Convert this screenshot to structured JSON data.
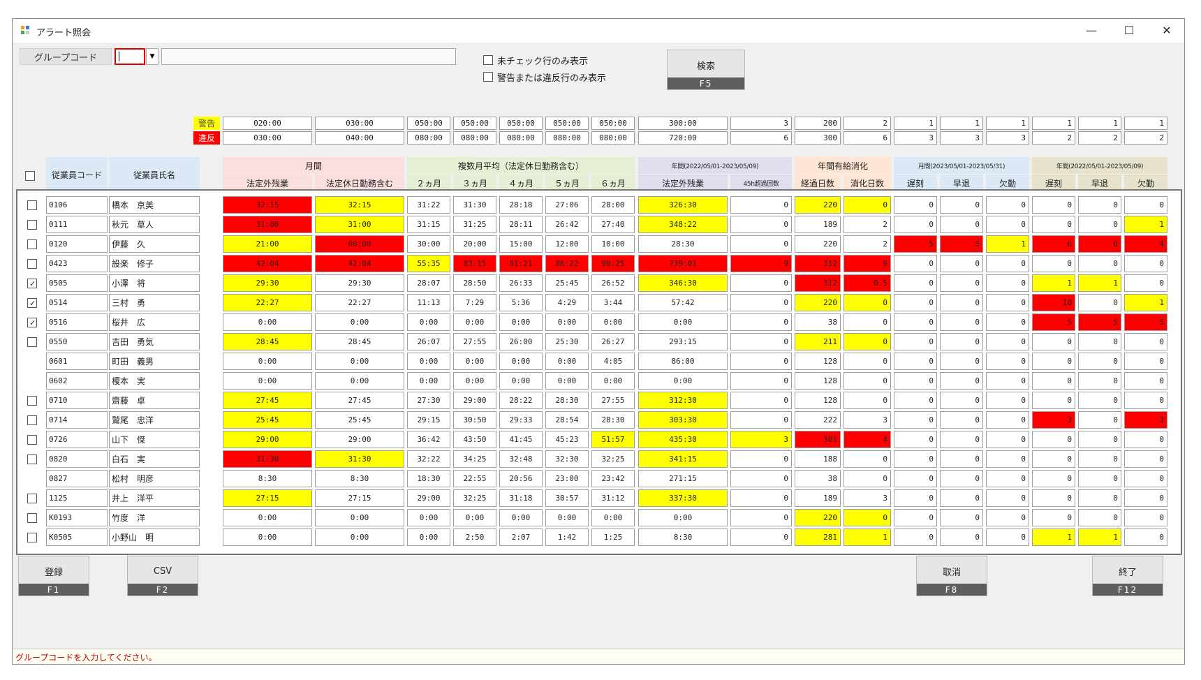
{
  "window": {
    "title": "アラート照会",
    "minimize": "—",
    "maximize": "☐",
    "close": "✕"
  },
  "search": {
    "group_code_label": "グループコード",
    "group_code_value": "",
    "dropdown_arrow": "▼",
    "group_name_value": "",
    "only_unchecked_label": "未チェック行のみ表示",
    "only_warning_label": "警告または違反行のみ表示",
    "search_button_label": "検索",
    "search_button_key": "F5"
  },
  "thresholds": {
    "warning_label": "警告",
    "violation_label": "違反",
    "warning": [
      "020:00",
      "030:00",
      "050:00",
      "050:00",
      "050:00",
      "050:00",
      "050:00",
      "300:00",
      "3",
      "200",
      "2",
      "1",
      "1",
      "1",
      "1",
      "1",
      "1"
    ],
    "violation": [
      "030:00",
      "040:00",
      "080:00",
      "080:00",
      "080:00",
      "080:00",
      "080:00",
      "720:00",
      "6",
      "300",
      "6",
      "3",
      "3",
      "3",
      "2",
      "2",
      "2"
    ]
  },
  "headers": {
    "employee_code": "従業員コード",
    "employee_name": "従業員氏名",
    "group_monthly": "月間",
    "group_multi_month": "複数月平均（法定休日勤務含む）",
    "group_yearly": "年間(2022/05/01-2023/05/09)",
    "group_paid_leave": "年間有給消化",
    "group_monthly_att": "月間(2023/05/01-2023/05/31)",
    "group_yearly_att": "年間(2022/05/01-2023/05/09)",
    "columns": [
      "法定外残業",
      "法定休日勤務含む",
      "２ヵ月",
      "３ヵ月",
      "４ヵ月",
      "５ヵ月",
      "６ヵ月",
      "法定外残業",
      "45h超過回数",
      "経過日数",
      "消化日数",
      "遅刻",
      "早退",
      "欠勤",
      "遅刻",
      "早退",
      "欠勤"
    ]
  },
  "colors": {
    "warning": "#ffff00",
    "violation": "#ff0000",
    "monthly_head": "#fbdede",
    "multi_head": "#e4efd4",
    "yearly_head": "#e2dcef",
    "leave_head": "#fde4d3",
    "att_head": "#dbe9f7",
    "yatt_head": "#e7e2cc",
    "code_head": "#dbe8f6"
  },
  "rows": [
    {
      "checkbox": "unchecked",
      "code": "0106",
      "name": "橋本　京美",
      "values": [
        "32:15",
        "32:15",
        "31:22",
        "31:30",
        "28:18",
        "27:06",
        "28:00",
        "326:30",
        "0",
        "220",
        "0",
        "0",
        "0",
        "0",
        "0",
        "0",
        "0"
      ],
      "levels": [
        2,
        1,
        0,
        0,
        0,
        0,
        0,
        1,
        0,
        1,
        1,
        0,
        0,
        0,
        0,
        0,
        0
      ]
    },
    {
      "checkbox": "unchecked",
      "code": "0111",
      "name": "秋元　草人",
      "values": [
        "31:00",
        "31:00",
        "31:15",
        "31:25",
        "28:11",
        "26:42",
        "27:40",
        "348:22",
        "0",
        "189",
        "2",
        "0",
        "0",
        "0",
        "0",
        "0",
        "1"
      ],
      "levels": [
        2,
        1,
        0,
        0,
        0,
        0,
        0,
        1,
        0,
        0,
        0,
        0,
        0,
        0,
        0,
        0,
        1
      ]
    },
    {
      "checkbox": "unchecked",
      "code": "0120",
      "name": "伊藤　久",
      "values": [
        "21:00",
        "60:00",
        "30:00",
        "20:00",
        "15:00",
        "12:00",
        "10:00",
        "28:30",
        "0",
        "220",
        "2",
        "5",
        "5",
        "1",
        "6",
        "6",
        "4"
      ],
      "levels": [
        1,
        2,
        0,
        0,
        0,
        0,
        0,
        0,
        0,
        0,
        0,
        2,
        2,
        1,
        2,
        2,
        2
      ]
    },
    {
      "checkbox": "unchecked",
      "code": "0423",
      "name": "設楽　修子",
      "values": [
        "42:04",
        "42:04",
        "55:35",
        "83:15",
        "81:21",
        "86:22",
        "90:25",
        "739:01",
        "9",
        "312",
        "9",
        "0",
        "0",
        "0",
        "0",
        "0",
        "0"
      ],
      "levels": [
        2,
        2,
        1,
        2,
        2,
        2,
        2,
        2,
        2,
        2,
        2,
        0,
        0,
        0,
        0,
        0,
        0
      ]
    },
    {
      "checkbox": "checked",
      "code": "0505",
      "name": "小澤　将",
      "values": [
        "29:30",
        "29:30",
        "28:07",
        "28:50",
        "26:33",
        "25:45",
        "26:52",
        "346:30",
        "0",
        "312",
        "0.5",
        "0",
        "0",
        "0",
        "1",
        "1",
        "0"
      ],
      "levels": [
        1,
        0,
        0,
        0,
        0,
        0,
        0,
        1,
        0,
        2,
        2,
        0,
        0,
        0,
        1,
        1,
        0
      ]
    },
    {
      "checkbox": "checked",
      "code": "0514",
      "name": "三村　勇",
      "values": [
        "22:27",
        "22:27",
        "11:13",
        "7:29",
        "5:36",
        "4:29",
        "3:44",
        "57:42",
        "0",
        "220",
        "0",
        "0",
        "0",
        "0",
        "10",
        "0",
        "1"
      ],
      "levels": [
        1,
        0,
        0,
        0,
        0,
        0,
        0,
        0,
        0,
        1,
        1,
        0,
        0,
        0,
        2,
        0,
        1
      ]
    },
    {
      "checkbox": "checked",
      "code": "0516",
      "name": "桜井　広",
      "values": [
        "0:00",
        "0:00",
        "0:00",
        "0:00",
        "0:00",
        "0:00",
        "0:00",
        "0:00",
        "0",
        "38",
        "0",
        "0",
        "0",
        "0",
        "5",
        "5",
        "5"
      ],
      "levels": [
        0,
        0,
        0,
        0,
        0,
        0,
        0,
        0,
        0,
        0,
        0,
        0,
        0,
        0,
        2,
        2,
        2
      ]
    },
    {
      "checkbox": "unchecked",
      "code": "0550",
      "name": "吉田　勇気",
      "values": [
        "28:45",
        "28:45",
        "26:07",
        "27:55",
        "26:00",
        "25:30",
        "26:27",
        "293:15",
        "0",
        "211",
        "0",
        "0",
        "0",
        "0",
        "0",
        "0",
        "0"
      ],
      "levels": [
        1,
        0,
        0,
        0,
        0,
        0,
        0,
        0,
        0,
        1,
        1,
        0,
        0,
        0,
        0,
        0,
        0
      ]
    },
    {
      "checkbox": "none",
      "code": "0601",
      "name": "町田　義男",
      "values": [
        "0:00",
        "0:00",
        "0:00",
        "0:00",
        "0:00",
        "0:00",
        "4:05",
        "86:00",
        "0",
        "128",
        "0",
        "0",
        "0",
        "0",
        "0",
        "0",
        "0"
      ],
      "levels": [
        0,
        0,
        0,
        0,
        0,
        0,
        0,
        0,
        0,
        0,
        0,
        0,
        0,
        0,
        0,
        0,
        0
      ]
    },
    {
      "checkbox": "none",
      "code": "0602",
      "name": "榎本　実",
      "values": [
        "0:00",
        "0:00",
        "0:00",
        "0:00",
        "0:00",
        "0:00",
        "0:00",
        "0:00",
        "0",
        "128",
        "0",
        "0",
        "0",
        "0",
        "0",
        "0",
        "0"
      ],
      "levels": [
        0,
        0,
        0,
        0,
        0,
        0,
        0,
        0,
        0,
        0,
        0,
        0,
        0,
        0,
        0,
        0,
        0
      ]
    },
    {
      "checkbox": "unchecked",
      "code": "0710",
      "name": "齋藤　卓",
      "values": [
        "27:45",
        "27:45",
        "27:30",
        "29:00",
        "28:22",
        "28:30",
        "27:55",
        "312:30",
        "0",
        "128",
        "0",
        "0",
        "0",
        "0",
        "0",
        "0",
        "0"
      ],
      "levels": [
        1,
        0,
        0,
        0,
        0,
        0,
        0,
        1,
        0,
        0,
        0,
        0,
        0,
        0,
        0,
        0,
        0
      ]
    },
    {
      "checkbox": "unchecked",
      "code": "0714",
      "name": "鷲尾　忠洋",
      "values": [
        "25:45",
        "25:45",
        "29:15",
        "30:50",
        "29:33",
        "28:54",
        "28:30",
        "303:30",
        "0",
        "222",
        "3",
        "0",
        "0",
        "0",
        "3",
        "0",
        "3"
      ],
      "levels": [
        1,
        0,
        0,
        0,
        0,
        0,
        0,
        1,
        0,
        0,
        0,
        0,
        0,
        0,
        2,
        0,
        2
      ]
    },
    {
      "checkbox": "unchecked",
      "code": "0726",
      "name": "山下　傑",
      "values": [
        "29:00",
        "29:00",
        "36:42",
        "43:50",
        "41:45",
        "45:23",
        "51:57",
        "435:30",
        "3",
        "301",
        "4",
        "0",
        "0",
        "0",
        "0",
        "0",
        "0"
      ],
      "levels": [
        1,
        0,
        0,
        0,
        0,
        0,
        1,
        1,
        1,
        2,
        2,
        0,
        0,
        0,
        0,
        0,
        0
      ]
    },
    {
      "checkbox": "unchecked",
      "code": "0820",
      "name": "白石　実",
      "values": [
        "31:30",
        "31:30",
        "32:22",
        "34:25",
        "32:48",
        "32:30",
        "32:25",
        "341:15",
        "0",
        "188",
        "0",
        "0",
        "0",
        "0",
        "0",
        "0",
        "0"
      ],
      "levels": [
        2,
        1,
        0,
        0,
        0,
        0,
        0,
        1,
        0,
        0,
        0,
        0,
        0,
        0,
        0,
        0,
        0
      ]
    },
    {
      "checkbox": "none",
      "code": "0827",
      "name": "松村　明彦",
      "values": [
        "8:30",
        "8:30",
        "18:30",
        "22:55",
        "20:56",
        "23:00",
        "23:42",
        "271:15",
        "0",
        "38",
        "0",
        "0",
        "0",
        "0",
        "0",
        "0",
        "0"
      ],
      "levels": [
        0,
        0,
        0,
        0,
        0,
        0,
        0,
        0,
        0,
        0,
        0,
        0,
        0,
        0,
        0,
        0,
        0
      ]
    },
    {
      "checkbox": "unchecked",
      "code": "1125",
      "name": "井上　洋平",
      "values": [
        "27:15",
        "27:15",
        "29:00",
        "32:25",
        "31:18",
        "30:57",
        "31:12",
        "337:30",
        "0",
        "189",
        "3",
        "0",
        "0",
        "0",
        "0",
        "0",
        "0"
      ],
      "levels": [
        1,
        0,
        0,
        0,
        0,
        0,
        0,
        1,
        0,
        0,
        0,
        0,
        0,
        0,
        0,
        0,
        0
      ]
    },
    {
      "checkbox": "unchecked",
      "code": "K0193",
      "name": "竹度　洋",
      "values": [
        "0:00",
        "0:00",
        "0:00",
        "0:00",
        "0:00",
        "0:00",
        "0:00",
        "0:00",
        "0",
        "220",
        "0",
        "0",
        "0",
        "0",
        "0",
        "0",
        "0"
      ],
      "levels": [
        0,
        0,
        0,
        0,
        0,
        0,
        0,
        0,
        0,
        1,
        1,
        0,
        0,
        0,
        0,
        0,
        0
      ]
    },
    {
      "checkbox": "unchecked",
      "code": "K0505",
      "name": "小野山　明",
      "values": [
        "0:00",
        "0:00",
        "0:00",
        "2:50",
        "2:07",
        "1:42",
        "1:25",
        "8:30",
        "0",
        "281",
        "1",
        "0",
        "0",
        "0",
        "1",
        "1",
        "0"
      ],
      "levels": [
        0,
        0,
        0,
        0,
        0,
        0,
        0,
        0,
        0,
        1,
        1,
        0,
        0,
        0,
        1,
        1,
        0
      ]
    }
  ],
  "buttons": {
    "register_label": "登録",
    "register_key": "F1",
    "csv_label": "CSV",
    "csv_key": "F2",
    "cancel_label": "取消",
    "cancel_key": "F8",
    "exit_label": "終了",
    "exit_key": "F12"
  },
  "status_message": "グループコードを入力してください。"
}
